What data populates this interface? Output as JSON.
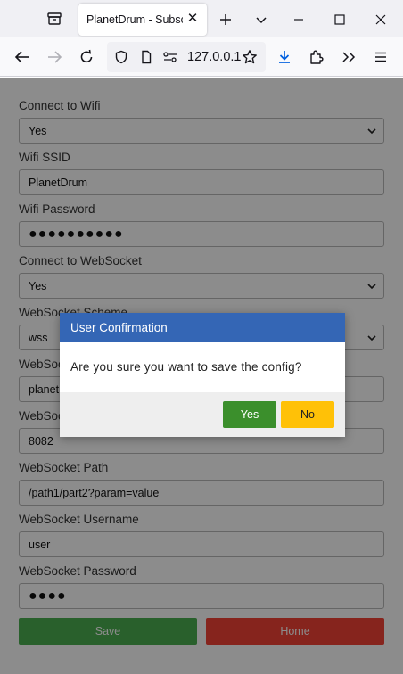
{
  "browser": {
    "tab_title": "PlanetDrum - Subscribe",
    "url": "127.0.0.1"
  },
  "form": {
    "connect_wifi": {
      "label": "Connect to Wifi",
      "value": "Yes"
    },
    "wifi_ssid": {
      "label": "Wifi SSID",
      "value": "PlanetDrum"
    },
    "wifi_password": {
      "label": "Wifi Password",
      "value": "●●●●●●●●●●"
    },
    "connect_websocket": {
      "label": "Connect to WebSocket",
      "value": "Yes"
    },
    "ws_scheme": {
      "label": "WebSocket Scheme",
      "value": "wss"
    },
    "ws_host": {
      "label": "WebSocket Host",
      "value": "planet"
    },
    "ws_port": {
      "label": "WebSocket Port",
      "value": "8082"
    },
    "ws_path": {
      "label": "WebSocket Path",
      "value": "/path1/part2?param=value"
    },
    "ws_username": {
      "label": "WebSocket Username",
      "value": "user"
    },
    "ws_password": {
      "label": "WebSocket Password",
      "value": "●●●●"
    },
    "save_label": "Save",
    "home_label": "Home"
  },
  "modal": {
    "title": "User Confirmation",
    "message": "Are you sure you want to save the config?",
    "yes_label": "Yes",
    "no_label": "No"
  },
  "colors": {
    "modal_header": "#3466b5",
    "yes_button": "#3b8f2c",
    "no_button": "#ffc107",
    "save_button": "#4caf50",
    "home_button": "#f44336"
  }
}
